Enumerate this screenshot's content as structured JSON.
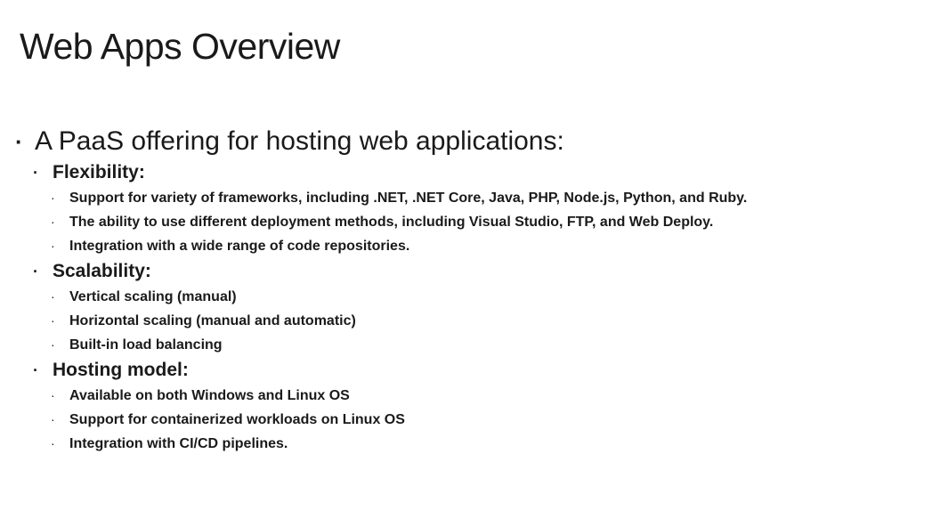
{
  "slide": {
    "title": "Web Apps Overview",
    "intro": "A PaaS offering for hosting web applications:",
    "bullet_glyph": "·",
    "sections": [
      {
        "heading": "Flexibility:",
        "items": [
          "Support for variety of frameworks, including .NET, .NET Core, Java, PHP, Node.js, Python, and Ruby.",
          "The ability to use different deployment methods, including Visual Studio, FTP, and Web Deploy.",
          "Integration with a wide range of code repositories."
        ]
      },
      {
        "heading": "Scalability:",
        "items": [
          "Vertical scaling (manual)",
          "Horizontal scaling (manual and automatic)",
          "Built-in load balancing"
        ]
      },
      {
        "heading": "Hosting model:",
        "items": [
          "Available on both Windows and Linux OS",
          "Support for containerized workloads on Linux OS",
          "Integration with CI/CD pipelines."
        ]
      }
    ]
  }
}
